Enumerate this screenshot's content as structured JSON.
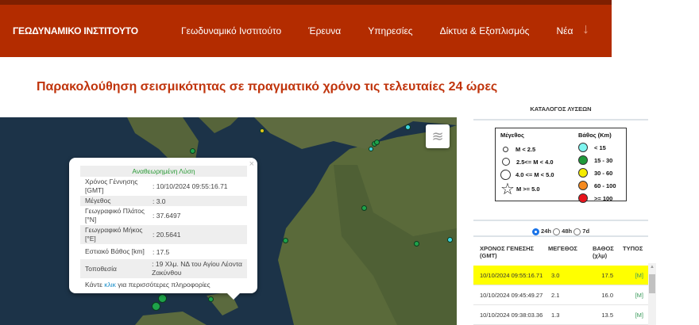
{
  "header": {
    "logo": "ΓΕΩΔΥΝΑΜΙΚΟ ΙΝΣΤΙΤΟΥΤΟ",
    "nav": [
      "Γεωδυναμικό Ινστιτούτο",
      "Έρευνα",
      "Υπηρεσίες",
      "Δίκτυα & Εξοπλισμός",
      "Νέα"
    ]
  },
  "page_title": "Παρακολούθηση σεισμικότητας σε πραγματικό χρόνο τις τελευταίες 24 ώρες",
  "popup": {
    "heading": "Αναθεωρημένη Λύση",
    "rows": [
      {
        "k": "Χρόνος Γέννησης [GMT]",
        "v": ": 10/10/2024 09:55:16.71"
      },
      {
        "k": "Μέγεθος",
        "v": ": 3.0"
      },
      {
        "k": "Γεωγραφικό Πλάτος [°N]",
        "v": ": 37.6497"
      },
      {
        "k": "Γεωγραφικό Μήκος [°E]",
        "v": ": 20.5641"
      },
      {
        "k": "Εστιακό Βάθος [km]",
        "v": ": 17.5"
      },
      {
        "k": "Τοποθεσία",
        "v": ": 19 Χλμ. ΝΔ του Αγίου Λέοντα Ζακύνθου"
      }
    ],
    "footer_pre": "Κάντε ",
    "footer_link": "κλικ",
    "footer_post": " για περισσότερες πληροφορίες",
    "close": "×"
  },
  "panel": {
    "title": "ΚΑΤΑΛΟΓΟΣ ΛΥΣΕΩΝ",
    "legend": {
      "mag_title": "Μέγεθος",
      "mag": [
        "M < 2.5",
        "2.5<= M < 4.0",
        "4.0 <= M < 5.0",
        "M >= 5.0"
      ],
      "depth_title": "Βάθος (Km)",
      "depth": [
        {
          "label": "< 15",
          "color": "#7ff5f0"
        },
        {
          "label": "15 - 30",
          "color": "#1f9a3a"
        },
        {
          "label": "30 - 60",
          "color": "#f5ec00"
        },
        {
          "label": "60 - 100",
          "color": "#f58a1f"
        },
        {
          "label": ">= 100",
          "color": "#e8141c"
        }
      ]
    },
    "radios": [
      "24h",
      "48h",
      "7d"
    ],
    "selected": "24h"
  },
  "table": {
    "headers": [
      "ΧΡΟΝΟΣ ΓΕΝΕΣΗΣ (GMT)",
      "ΜΕΓΕΘΟΣ",
      "ΒΑΘΟΣ (χλμ)",
      "ΤΥΠΟΣ"
    ],
    "rows": [
      [
        "10/10/2024 09:55:16.71",
        "3.0",
        "17.5",
        "[M]"
      ],
      [
        "10/10/2024 09:45:49.27",
        "2.1",
        "16.0",
        "[M]"
      ],
      [
        "10/10/2024 09:38:03.36",
        "1.3",
        "13.5",
        "[M]"
      ]
    ]
  }
}
